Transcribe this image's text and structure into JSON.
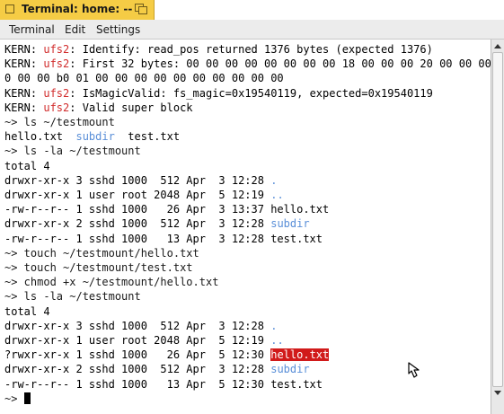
{
  "window": {
    "title": "Terminal: home: --"
  },
  "menu": {
    "items": [
      "Terminal",
      "Edit",
      "Settings"
    ]
  },
  "terminal": {
    "lines": [
      {
        "segments": [
          {
            "t": "KERN: ",
            "c": ""
          },
          {
            "t": "ufs2",
            "c": "red"
          },
          {
            "t": ": Identify: read_pos returned 1376 bytes (expected 1376)",
            "c": ""
          }
        ]
      },
      {
        "segments": [
          {
            "t": "KERN: ",
            "c": ""
          },
          {
            "t": "ufs2",
            "c": "red"
          },
          {
            "t": ": First 32 bytes: 00 00 00 00 00 00 00 00 18 00 00 00 20 00 00 00 28 0",
            "c": ""
          }
        ]
      },
      {
        "segments": [
          {
            "t": "0 00 00 b0 01 00 00 00 00 00 00 00 00 00 00",
            "c": ""
          }
        ]
      },
      {
        "segments": [
          {
            "t": "KERN: ",
            "c": ""
          },
          {
            "t": "ufs2",
            "c": "red"
          },
          {
            "t": ": IsMagicValid: fs_magic=0x19540119, expected=0x19540119",
            "c": ""
          }
        ]
      },
      {
        "segments": [
          {
            "t": "KERN: ",
            "c": ""
          },
          {
            "t": "ufs2",
            "c": "red"
          },
          {
            "t": ": Valid super block",
            "c": ""
          }
        ]
      },
      {
        "segments": [
          {
            "t": "~> ls ~/testmount",
            "c": "prompt"
          }
        ]
      },
      {
        "segments": [
          {
            "t": "hello.txt  ",
            "c": ""
          },
          {
            "t": "subdir",
            "c": "blue"
          },
          {
            "t": "  test.txt",
            "c": ""
          }
        ]
      },
      {
        "segments": [
          {
            "t": "~> ls -la ~/testmount",
            "c": "prompt"
          }
        ]
      },
      {
        "segments": [
          {
            "t": "total 4",
            "c": ""
          }
        ]
      },
      {
        "segments": [
          {
            "t": "drwxr-xr-x 3 sshd 1000  512 Apr  3 12:28 ",
            "c": ""
          },
          {
            "t": ".",
            "c": "blue"
          }
        ]
      },
      {
        "segments": [
          {
            "t": "drwxr-xr-x 1 user root 2048 Apr  5 12:19 ",
            "c": ""
          },
          {
            "t": "..",
            "c": "blue"
          }
        ]
      },
      {
        "segments": [
          {
            "t": "-rw-r--r-- 1 sshd 1000   26 Apr  3 13:37 hello.txt",
            "c": ""
          }
        ]
      },
      {
        "segments": [
          {
            "t": "drwxr-xr-x 2 sshd 1000  512 Apr  3 12:28 ",
            "c": ""
          },
          {
            "t": "subdir",
            "c": "blue"
          }
        ]
      },
      {
        "segments": [
          {
            "t": "-rw-r--r-- 1 sshd 1000   13 Apr  3 12:28 test.txt",
            "c": ""
          }
        ]
      },
      {
        "segments": [
          {
            "t": "~> touch ~/testmount/hello.txt",
            "c": "prompt"
          }
        ]
      },
      {
        "segments": [
          {
            "t": "~> touch ~/testmount/test.txt",
            "c": "prompt"
          }
        ]
      },
      {
        "segments": [
          {
            "t": "~> chmod +x ~/testmount/hello.txt",
            "c": "prompt"
          }
        ]
      },
      {
        "segments": [
          {
            "t": "~> ls -la ~/testmount",
            "c": "prompt"
          }
        ]
      },
      {
        "segments": [
          {
            "t": "total 4",
            "c": ""
          }
        ]
      },
      {
        "segments": [
          {
            "t": "drwxr-xr-x 3 sshd 1000  512 Apr  3 12:28 ",
            "c": ""
          },
          {
            "t": ".",
            "c": "blue"
          }
        ]
      },
      {
        "segments": [
          {
            "t": "drwxr-xr-x 1 user root 2048 Apr  5 12:19 ",
            "c": ""
          },
          {
            "t": "..",
            "c": "blue"
          }
        ]
      },
      {
        "segments": [
          {
            "t": "?rwxr-xr-x 1 sshd 1000   26 Apr  5 12:30 ",
            "c": ""
          },
          {
            "t": "hello.txt",
            "c": "hl"
          }
        ]
      },
      {
        "segments": [
          {
            "t": "drwxr-xr-x 2 sshd 1000  512 Apr  3 12:28 ",
            "c": ""
          },
          {
            "t": "subdir",
            "c": "blue"
          }
        ]
      },
      {
        "segments": [
          {
            "t": "-rw-r--r-- 1 sshd 1000   13 Apr  5 12:30 test.txt",
            "c": ""
          }
        ]
      },
      {
        "segments": [
          {
            "t": "~> ",
            "c": "prompt"
          },
          {
            "t": "",
            "c": "cursor"
          }
        ]
      }
    ]
  },
  "icons": {
    "title_left": "window-box-icon",
    "zoom": "zoom-window-icon",
    "scroll_up": "arrow-up-icon",
    "scroll_down": "arrow-down-icon",
    "pointer": "mouse-pointer-icon"
  },
  "colors": {
    "title_tab": "#f5cc45",
    "kern_red": "#d12b2b",
    "dir_blue": "#5a8fd8",
    "highlight_red": "#d11a1a"
  }
}
